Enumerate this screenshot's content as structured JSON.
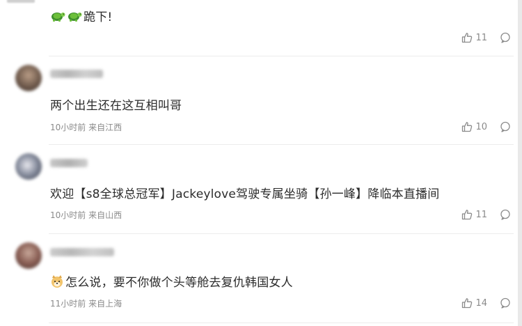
{
  "comments": [
    {
      "body_text": "跪下!",
      "body_emojis": [
        "turtle-emoji",
        "turtle-emoji"
      ],
      "meta": "",
      "likes": "11"
    },
    {
      "body_text": "两个出生还在这互相叫哥",
      "meta": "10小时前 来自江西",
      "likes": "10"
    },
    {
      "body_text": "欢迎【s8全球总冠军】Jackeylove驾驶专属坐骑【孙一峰】降临本直播间",
      "meta": "10小时前 来自山西",
      "likes": "11"
    },
    {
      "body_text": "怎么说，要不你做个头等舱去复仇韩国女人",
      "body_emojis": [
        "doge-emoji"
      ],
      "meta": "11小时前 来自上海",
      "likes": "14"
    }
  ],
  "icons": {
    "like": "thumbs-up-icon",
    "reply": "comment-icon"
  },
  "colors": {
    "meta_text": "#8a8a8a",
    "body_text": "#2b2b2b",
    "divider": "#ececec"
  }
}
